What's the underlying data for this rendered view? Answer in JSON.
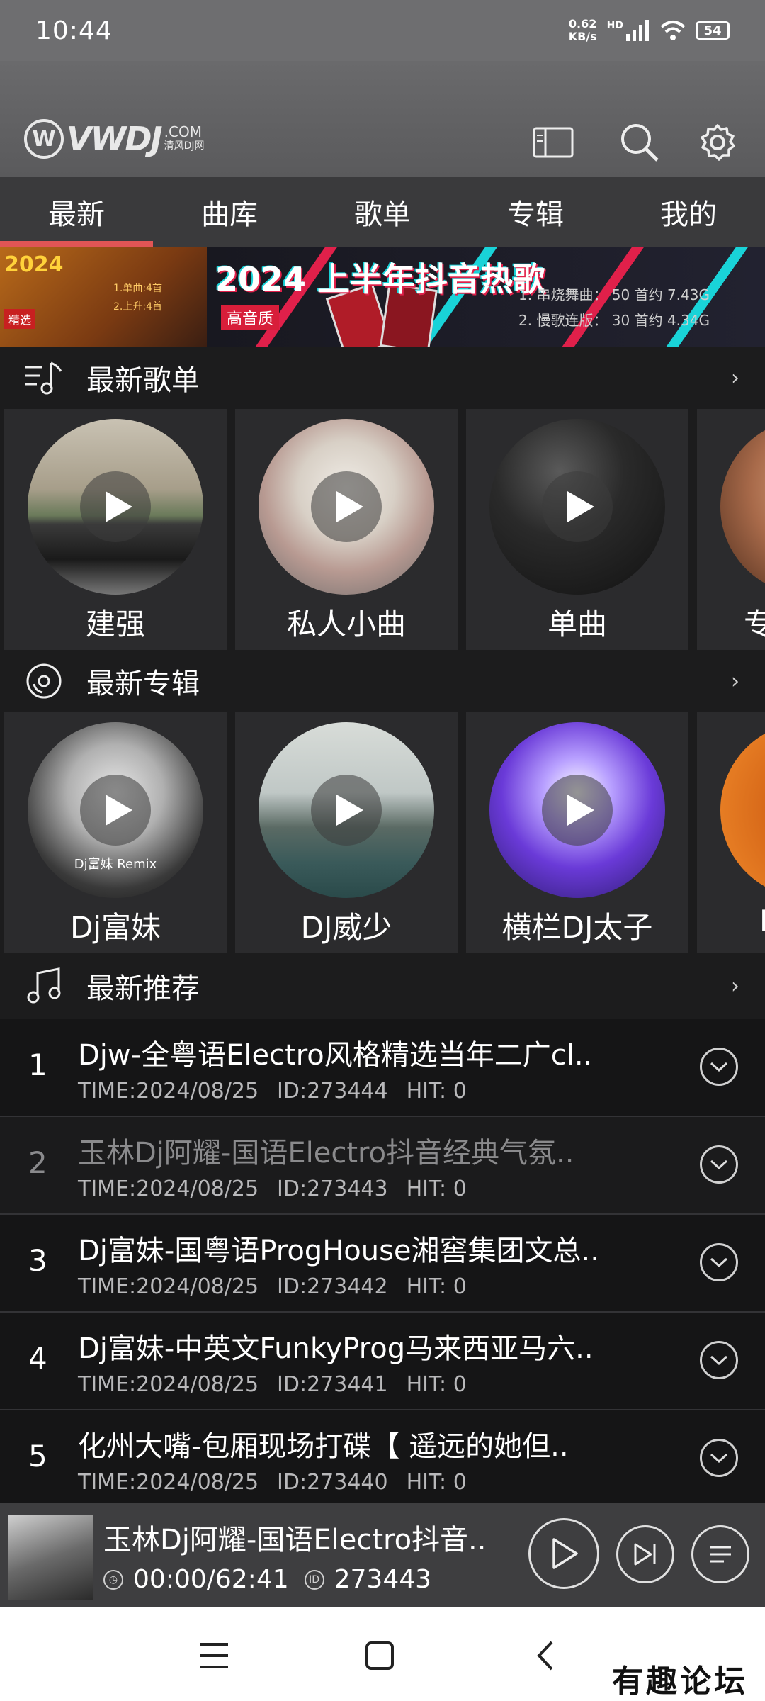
{
  "status_bar": {
    "time": "10:44",
    "speed_value": "0.62",
    "speed_unit": "KB/s",
    "network": "HD",
    "battery": "54"
  },
  "header": {
    "logo_text": "VWDJ",
    "logo_domain": ".COM",
    "logo_cn": "清风DJ网"
  },
  "tabs": [
    {
      "label": "最新",
      "active": true
    },
    {
      "label": "曲库"
    },
    {
      "label": "歌单"
    },
    {
      "label": "专辑"
    },
    {
      "label": "我的"
    }
  ],
  "banner": {
    "left_year": "2024",
    "left_tag": "精选",
    "left_lines": [
      "1.单曲:4首",
      "2.上升:4首"
    ],
    "title": "2024 上半年抖音热歌",
    "quality": "高音质",
    "line1": "1. 串烧舞曲：  50 首约 7.43G",
    "line2": "2. 慢歌连版：  30 首约 4.34G"
  },
  "playlists_section": {
    "title": "最新歌单",
    "more": "›"
  },
  "playlists": [
    {
      "label": "建强"
    },
    {
      "label": "私人小曲"
    },
    {
      "label": "单曲"
    },
    {
      "label": "专"
    }
  ],
  "albums_section": {
    "title": "最新专辑",
    "more": "›"
  },
  "albums": [
    {
      "label": "Dj富妹",
      "cover_text": "Dj富妹 Remix"
    },
    {
      "label": "DJ威少"
    },
    {
      "label": "横栏DJ太子"
    },
    {
      "label": "I"
    }
  ],
  "recommend_section": {
    "title": "最新推荐",
    "more": "›"
  },
  "tracks": [
    {
      "num": "1",
      "title": "Djw-全粤语Electro风格精选当年二广cl..",
      "time": "TIME:2024/08/25",
      "id": "ID:273444",
      "hit": "HIT:  0"
    },
    {
      "num": "2",
      "title": "玉林Dj阿耀-国语Electro抖音经典气氛..",
      "time": "TIME:2024/08/25",
      "id": "ID:273443",
      "hit": "HIT:  0",
      "playing": true
    },
    {
      "num": "3",
      "title": "Dj富妹-国粤语ProgHouse湘窖集团文总..",
      "time": "TIME:2024/08/25",
      "id": "ID:273442",
      "hit": "HIT:  0"
    },
    {
      "num": "4",
      "title": "Dj富妹-中英文FunkyProg马来西亚马六..",
      "time": "TIME:2024/08/25",
      "id": "ID:273441",
      "hit": "HIT:  0"
    },
    {
      "num": "5",
      "title": "化州大嘴-包厢现场打碟【 遥远的她但..",
      "time": "TIME:2024/08/25",
      "id": "ID:273440",
      "hit": "HIT:  0"
    }
  ],
  "player": {
    "title": "玉林Dj阿耀-国语Electro抖音..",
    "time": "00:00/62:41",
    "id": "273443"
  },
  "watermark": "有趣论坛"
}
